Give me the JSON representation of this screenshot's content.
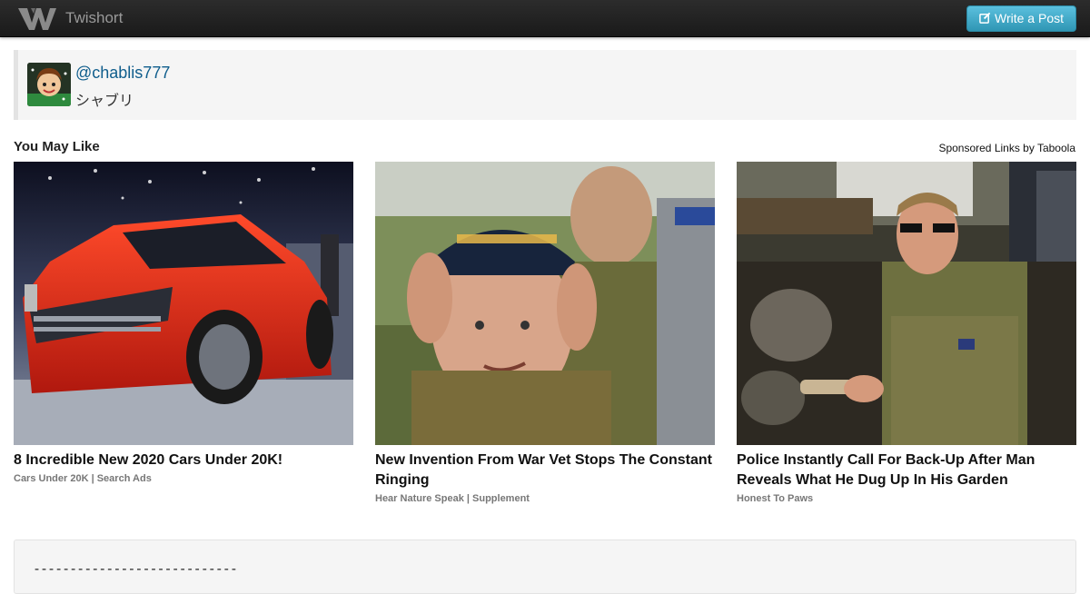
{
  "navbar": {
    "brand_name": "Twishort",
    "write_button_label": "Write a Post"
  },
  "author": {
    "username": "@chablis777",
    "display_name": "シャブリ"
  },
  "recommendations": {
    "title": "You May Like",
    "sponsored_label": "Sponsored Links by Taboola",
    "cards": [
      {
        "headline": "8 Incredible New 2020 Cars Under 20K!",
        "source": "Cars Under 20K | Search Ads"
      },
      {
        "headline": "New Invention From War Vet Stops The Constant Ringing",
        "source": "Hear Nature Speak | Supplement"
      },
      {
        "headline": "Police Instantly Call For Back-Up After Man Reveals What He Dug Up In His Garden",
        "source": "Honest To Paws"
      }
    ]
  },
  "post": {
    "divider_text": "----------------------------"
  }
}
